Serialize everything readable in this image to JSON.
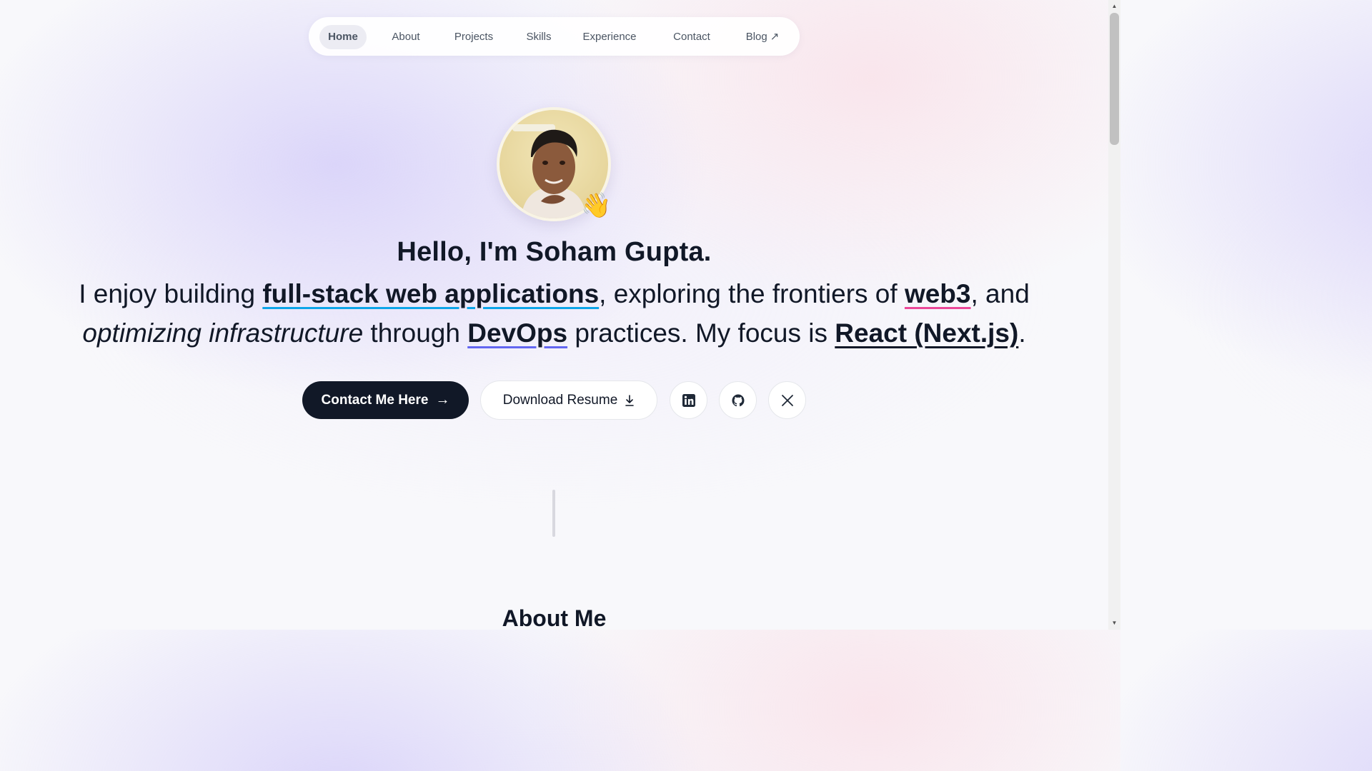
{
  "nav": {
    "items": [
      {
        "label": "Home",
        "active": true
      },
      {
        "label": "About"
      },
      {
        "label": "Projects"
      },
      {
        "label": "Skills"
      },
      {
        "label": "Experience"
      },
      {
        "label": "Contact"
      },
      {
        "label": "Blog",
        "icon": "external-arrow-icon"
      }
    ]
  },
  "hero": {
    "greeting": "Hello, I'm Soham Gupta.",
    "intro": {
      "p1": "I enjoy building ",
      "h1": "full-stack web applications",
      "p2": ", exploring the frontiers of ",
      "h2": "web3",
      "p3": ", and ",
      "em": "optimizing infrastructure",
      "p4": " through ",
      "h3": "DevOps",
      "p5": " practices. My focus is ",
      "h4": "React (Next.js)",
      "p6": "."
    },
    "avatar_emoji": "👋",
    "buttons": {
      "contact": "Contact Me Here",
      "contact_arrow": "→",
      "resume": "Download Resume"
    },
    "social": [
      {
        "name": "linkedin-icon"
      },
      {
        "name": "github-icon"
      },
      {
        "name": "x-icon"
      }
    ]
  },
  "about": {
    "title": "About Me"
  },
  "colors": {
    "accent_blue": "#0ea5e9",
    "accent_pink": "#ec4899",
    "accent_indigo": "#6366f1",
    "primary_dark": "#111827"
  }
}
